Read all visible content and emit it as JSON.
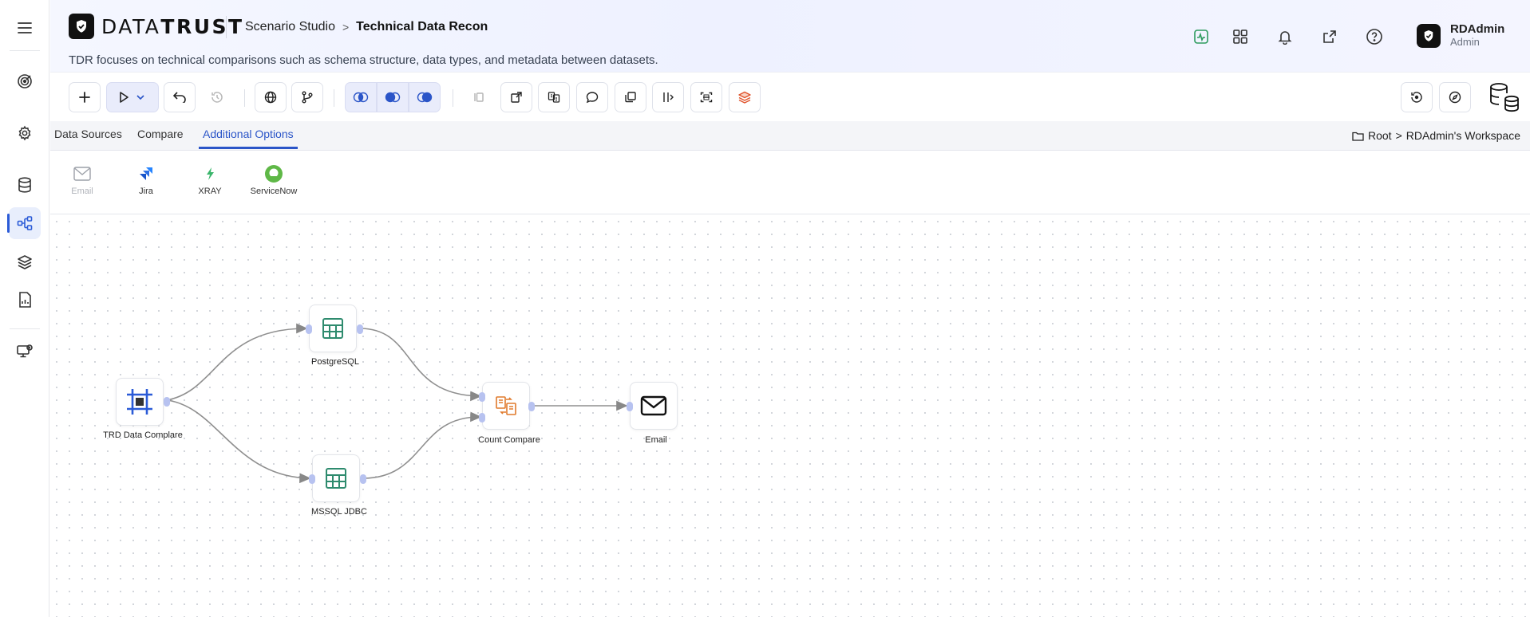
{
  "header": {
    "logo_text_light": "DATA",
    "logo_text_bold": "TRUST",
    "breadcrumb": [
      "Scenario Studio",
      "Technical Data Recon"
    ],
    "subtitle": "TDR focuses on technical comparisons such as schema structure, data types, and metadata between datasets.",
    "icons": [
      "activity-icon",
      "apps-grid-icon",
      "bell-icon",
      "external-link-icon",
      "help-icon"
    ],
    "user": {
      "name": "RDAdmin",
      "role": "Admin"
    }
  },
  "rail": {
    "items": [
      "menu-icon",
      "target-icon",
      "settings-icon",
      "database-icon",
      "flow-icon",
      "layers-icon",
      "report-icon",
      "monitor-icon"
    ],
    "active": "flow-icon"
  },
  "tabs": [
    {
      "label": "Data Sources",
      "active": false
    },
    {
      "label": "Compare",
      "active": false
    },
    {
      "label": "Additional Options",
      "active": true
    }
  ],
  "workspace": {
    "root": "Root",
    "name": "RDAdmin's Workspace"
  },
  "palette": [
    {
      "label": "Email",
      "disabled": true
    },
    {
      "label": "Jira",
      "disabled": false
    },
    {
      "label": "XRAY",
      "disabled": false
    },
    {
      "label": "ServiceNow",
      "disabled": false
    }
  ],
  "nodes": {
    "trd": "TRD Data Complare",
    "postgres": "PostgreSQL",
    "mssql": "MSSQL JDBC",
    "count": "Count Compare",
    "email": "Email"
  },
  "colors": {
    "accent": "#2b55c8",
    "table_green": "#2e8b6e",
    "count_orange": "#e07a2c",
    "port": "#b7c2f0"
  }
}
